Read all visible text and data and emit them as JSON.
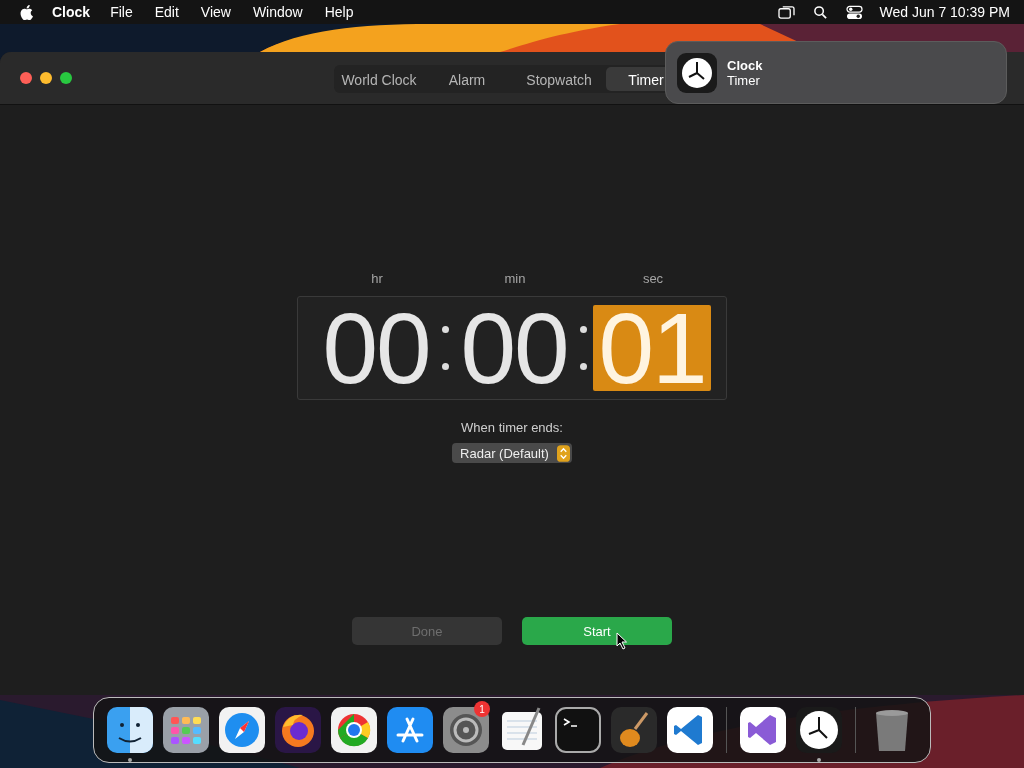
{
  "menu_bar": {
    "app_name": "Clock",
    "menus": [
      "File",
      "Edit",
      "View",
      "Window",
      "Help"
    ],
    "clock": "Wed Jun 7  10:39 PM"
  },
  "notification": {
    "app": "Clock",
    "message": "Timer"
  },
  "tabs": [
    {
      "label": "World Clock",
      "selected": false
    },
    {
      "label": "Alarm",
      "selected": false
    },
    {
      "label": "Stopwatch",
      "selected": false
    },
    {
      "label": "Timer",
      "selected": true
    }
  ],
  "timer": {
    "units": [
      {
        "label": "hr",
        "value": "00",
        "selected": false
      },
      {
        "label": "min",
        "value": "00",
        "selected": false
      },
      {
        "label": "sec",
        "value": "01",
        "selected": true
      }
    ]
  },
  "sound": {
    "label": "When timer ends:",
    "value": "Radar (Default)"
  },
  "buttons": [
    {
      "label": "Done",
      "kind": "secondary",
      "disabled": true
    },
    {
      "label": "Start",
      "kind": "primary",
      "disabled": false
    }
  ],
  "dock": [
    {
      "kind": "finder",
      "running": true
    },
    {
      "kind": "launchpad",
      "running": false
    },
    {
      "kind": "safari",
      "running": false
    },
    {
      "kind": "firefox",
      "running": false
    },
    {
      "kind": "chrome",
      "running": false
    },
    {
      "kind": "appstore",
      "running": false
    },
    {
      "kind": "settings",
      "running": false,
      "badge": "1"
    },
    {
      "kind": "textedit",
      "running": false
    },
    {
      "kind": "terminal",
      "running": false
    },
    {
      "kind": "garageband",
      "running": false
    },
    {
      "kind": "vscode",
      "running": false
    },
    {
      "kind": "separator"
    },
    {
      "kind": "visualstudio",
      "running": false
    },
    {
      "kind": "clock",
      "running": true
    },
    {
      "kind": "separator"
    },
    {
      "kind": "trash",
      "running": false
    }
  ]
}
